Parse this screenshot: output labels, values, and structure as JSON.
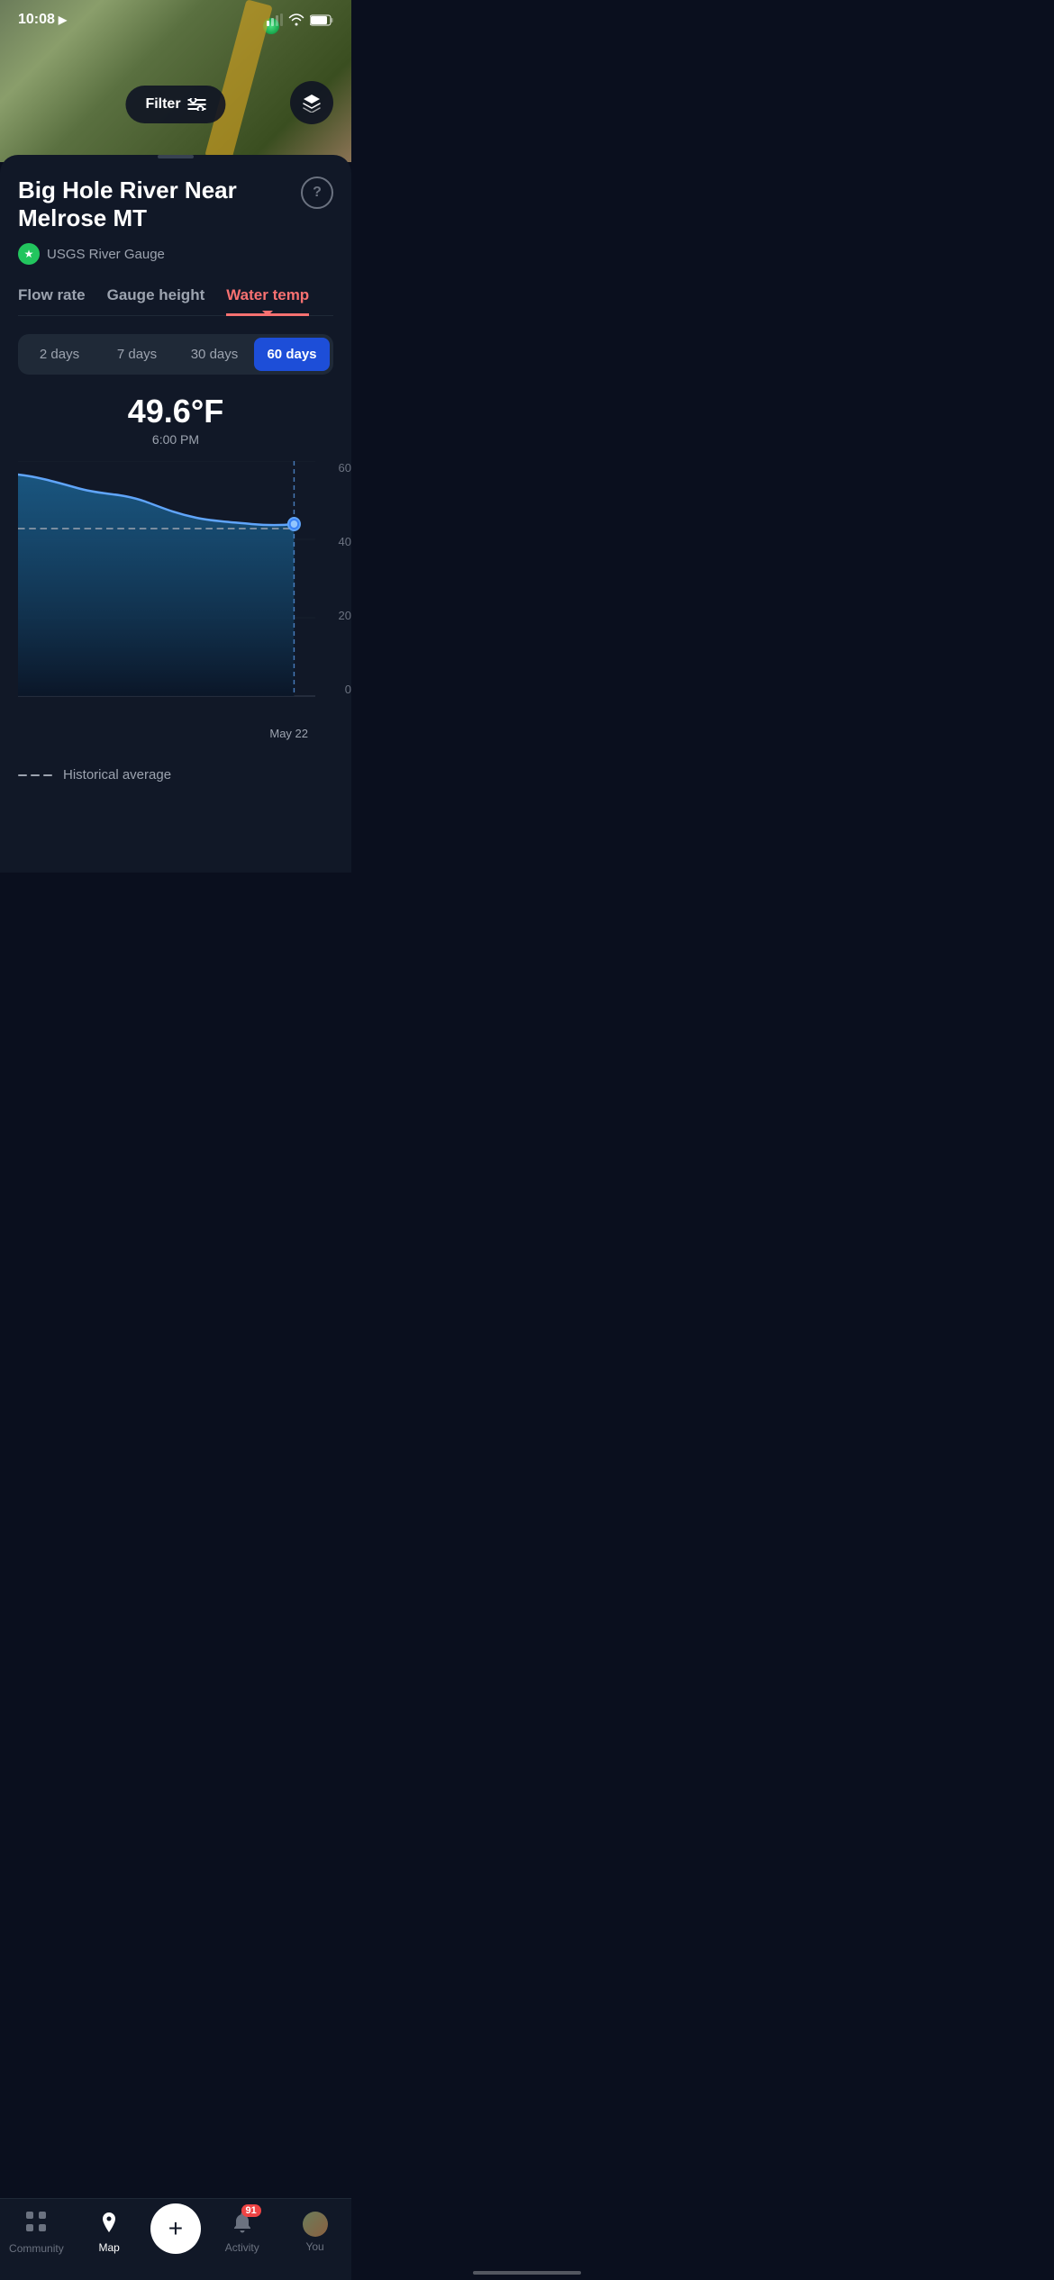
{
  "statusBar": {
    "time": "10:08",
    "locationIcon": "▶"
  },
  "mapControls": {
    "filterLabel": "Filter",
    "layersIcon": "⊞"
  },
  "station": {
    "title": "Big Hole River Near Melrose MT",
    "badgeText": "USGS River Gauge",
    "helpIcon": "?"
  },
  "tabs": [
    {
      "id": "flow",
      "label": "Flow rate",
      "active": false
    },
    {
      "id": "gauge",
      "label": "Gauge height",
      "active": false
    },
    {
      "id": "temp",
      "label": "Water temp",
      "active": true
    }
  ],
  "timeRange": {
    "options": [
      "2 days",
      "7 days",
      "30 days",
      "60 days"
    ],
    "selected": "60 days"
  },
  "currentReading": {
    "value": "49.6°F",
    "time": "6:00 PM"
  },
  "chart": {
    "yLabels": [
      "60",
      "40",
      "20",
      "0"
    ],
    "xLabel": "May 22",
    "dataPointLabel": "49.6°F",
    "avgLabel": "Historical average"
  },
  "bottomNav": {
    "items": [
      {
        "id": "community",
        "label": "Community",
        "icon": "⊞",
        "active": false
      },
      {
        "id": "map",
        "label": "Map",
        "icon": "📍",
        "active": true
      },
      {
        "id": "add",
        "label": "+",
        "icon": "+",
        "active": false
      },
      {
        "id": "activity",
        "label": "Activity",
        "icon": "🔔",
        "active": false,
        "badge": "91"
      },
      {
        "id": "you",
        "label": "You",
        "icon": "person",
        "active": false
      }
    ]
  }
}
